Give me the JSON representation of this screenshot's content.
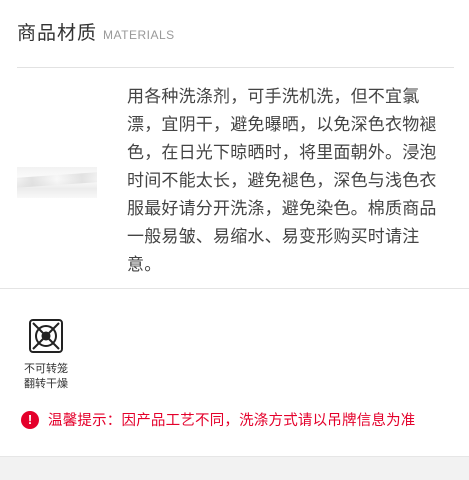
{
  "section": {
    "title": "商品材质",
    "subtitle": "MATERIALS"
  },
  "care_text": "用各种洗涤剂，可手洗机洗，但不宜氯漂，宜阴干，避免曝晒，以免深色衣物褪色，在日光下晾晒时，将里面朝外。浸泡时间不能太长，避免褪色，深色与浅色衣服最好请分开洗涤，避免染色。棉质商品一般易皱、易缩水、易变形购买时请注意。",
  "care_icon": {
    "icon": "no-tumble-dry-icon",
    "label_line1": "不可转笼",
    "label_line2": "翻转干燥"
  },
  "warning": {
    "icon": "exclamation-icon",
    "text": "温馨提示：因产品工艺不同，洗涤方式请以吊牌信息为准",
    "color": "#e4002b"
  }
}
